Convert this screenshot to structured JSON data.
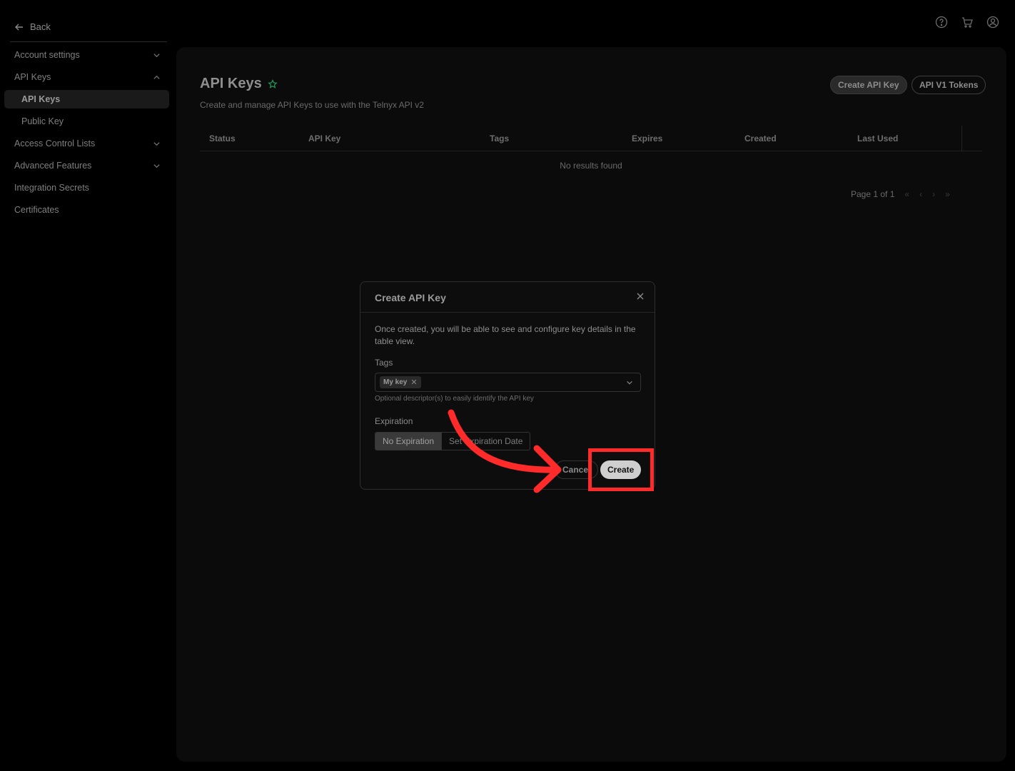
{
  "sidebar": {
    "back_label": "Back",
    "items": [
      {
        "label": "Account settings",
        "expand": "down"
      },
      {
        "label": "API Keys",
        "expand": "up"
      },
      {
        "label": "API Keys",
        "expand": ""
      },
      {
        "label": "Public Key",
        "expand": ""
      },
      {
        "label": "Access Control Lists",
        "expand": "down"
      },
      {
        "label": "Advanced Features",
        "expand": "down"
      },
      {
        "label": "Integration Secrets",
        "expand": ""
      },
      {
        "label": "Certificates",
        "expand": ""
      }
    ]
  },
  "header": {
    "icons": [
      "help-icon",
      "cart-icon",
      "account-icon"
    ]
  },
  "page": {
    "title": "API Keys",
    "subtitle": "Create and manage API Keys to use with the Telnyx API v2",
    "create_button": "Create API Key",
    "v1_button": "API V1 Tokens"
  },
  "table": {
    "columns": [
      "Status",
      "API Key",
      "Tags",
      "Expires",
      "Created",
      "Last Used"
    ],
    "empty_text": "No results found",
    "pagination": "Page 1 of 1"
  },
  "modal": {
    "title": "Create API Key",
    "description": "Once created, you will be able to see and configure key details in the table view.",
    "tags_label": "Tags",
    "tag_chip": "My key",
    "tags_help": "Optional descriptor(s) to easily identify the API key",
    "expiration_label": "Expiration",
    "expiration_options": [
      "No Expiration",
      "Set Expiration Date"
    ],
    "expiration_selected": "No Expiration",
    "cancel_label": "Cancel",
    "create_label": "Create"
  },
  "colors": {
    "accent_star": "#1f9d5a",
    "annotation": "#ff2a2a",
    "background": "#000000",
    "panel": "#0b0b0b"
  }
}
